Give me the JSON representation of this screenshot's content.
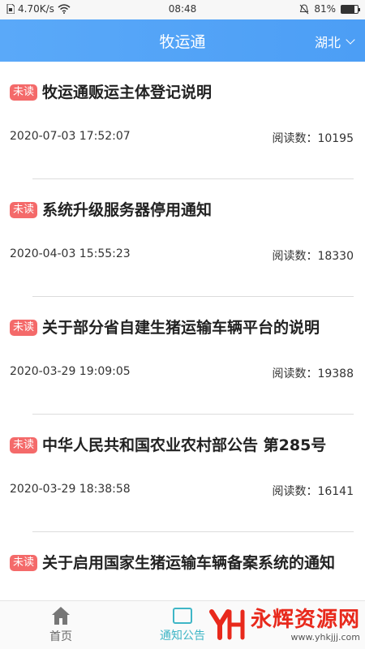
{
  "statusbar": {
    "speed": "4.70K/s",
    "time": "08:48",
    "battery": "81%",
    "battery_level": 0.81
  },
  "header": {
    "title": "牧运通",
    "region": "湖北"
  },
  "articles": [
    {
      "badge": "未读",
      "title": "牧运通贩运主体登记说明",
      "date": "2020-07-03 17:52:07",
      "reads": "阅读数：10195"
    },
    {
      "badge": "未读",
      "title": "系统升级服务器停用通知",
      "date": "2020-04-03 15:55:23",
      "reads": "阅读数：18330"
    },
    {
      "badge": "未读",
      "title": "关于部分省自建生猪运输车辆平台的说明",
      "date": "2020-03-29 19:09:05",
      "reads": "阅读数：19388"
    },
    {
      "badge": "未读",
      "title": "中华人民共和国农业农村部公告 第285号",
      "date": "2020-03-29 18:38:58",
      "reads": "阅读数：16141"
    },
    {
      "badge": "未读",
      "title": "关于启用国家生猪运输车辆备案系统的通知",
      "date": "",
      "reads": ""
    }
  ],
  "bottom_nav": {
    "home_label": "首页",
    "notice_label": "通知公告",
    "home_icon": "home-icon",
    "notice_icon": "notice-icon",
    "active_color": "#3fb6c6"
  },
  "watermark": {
    "brand": "永辉资源网",
    "url": "www.yhkjjj.com"
  }
}
